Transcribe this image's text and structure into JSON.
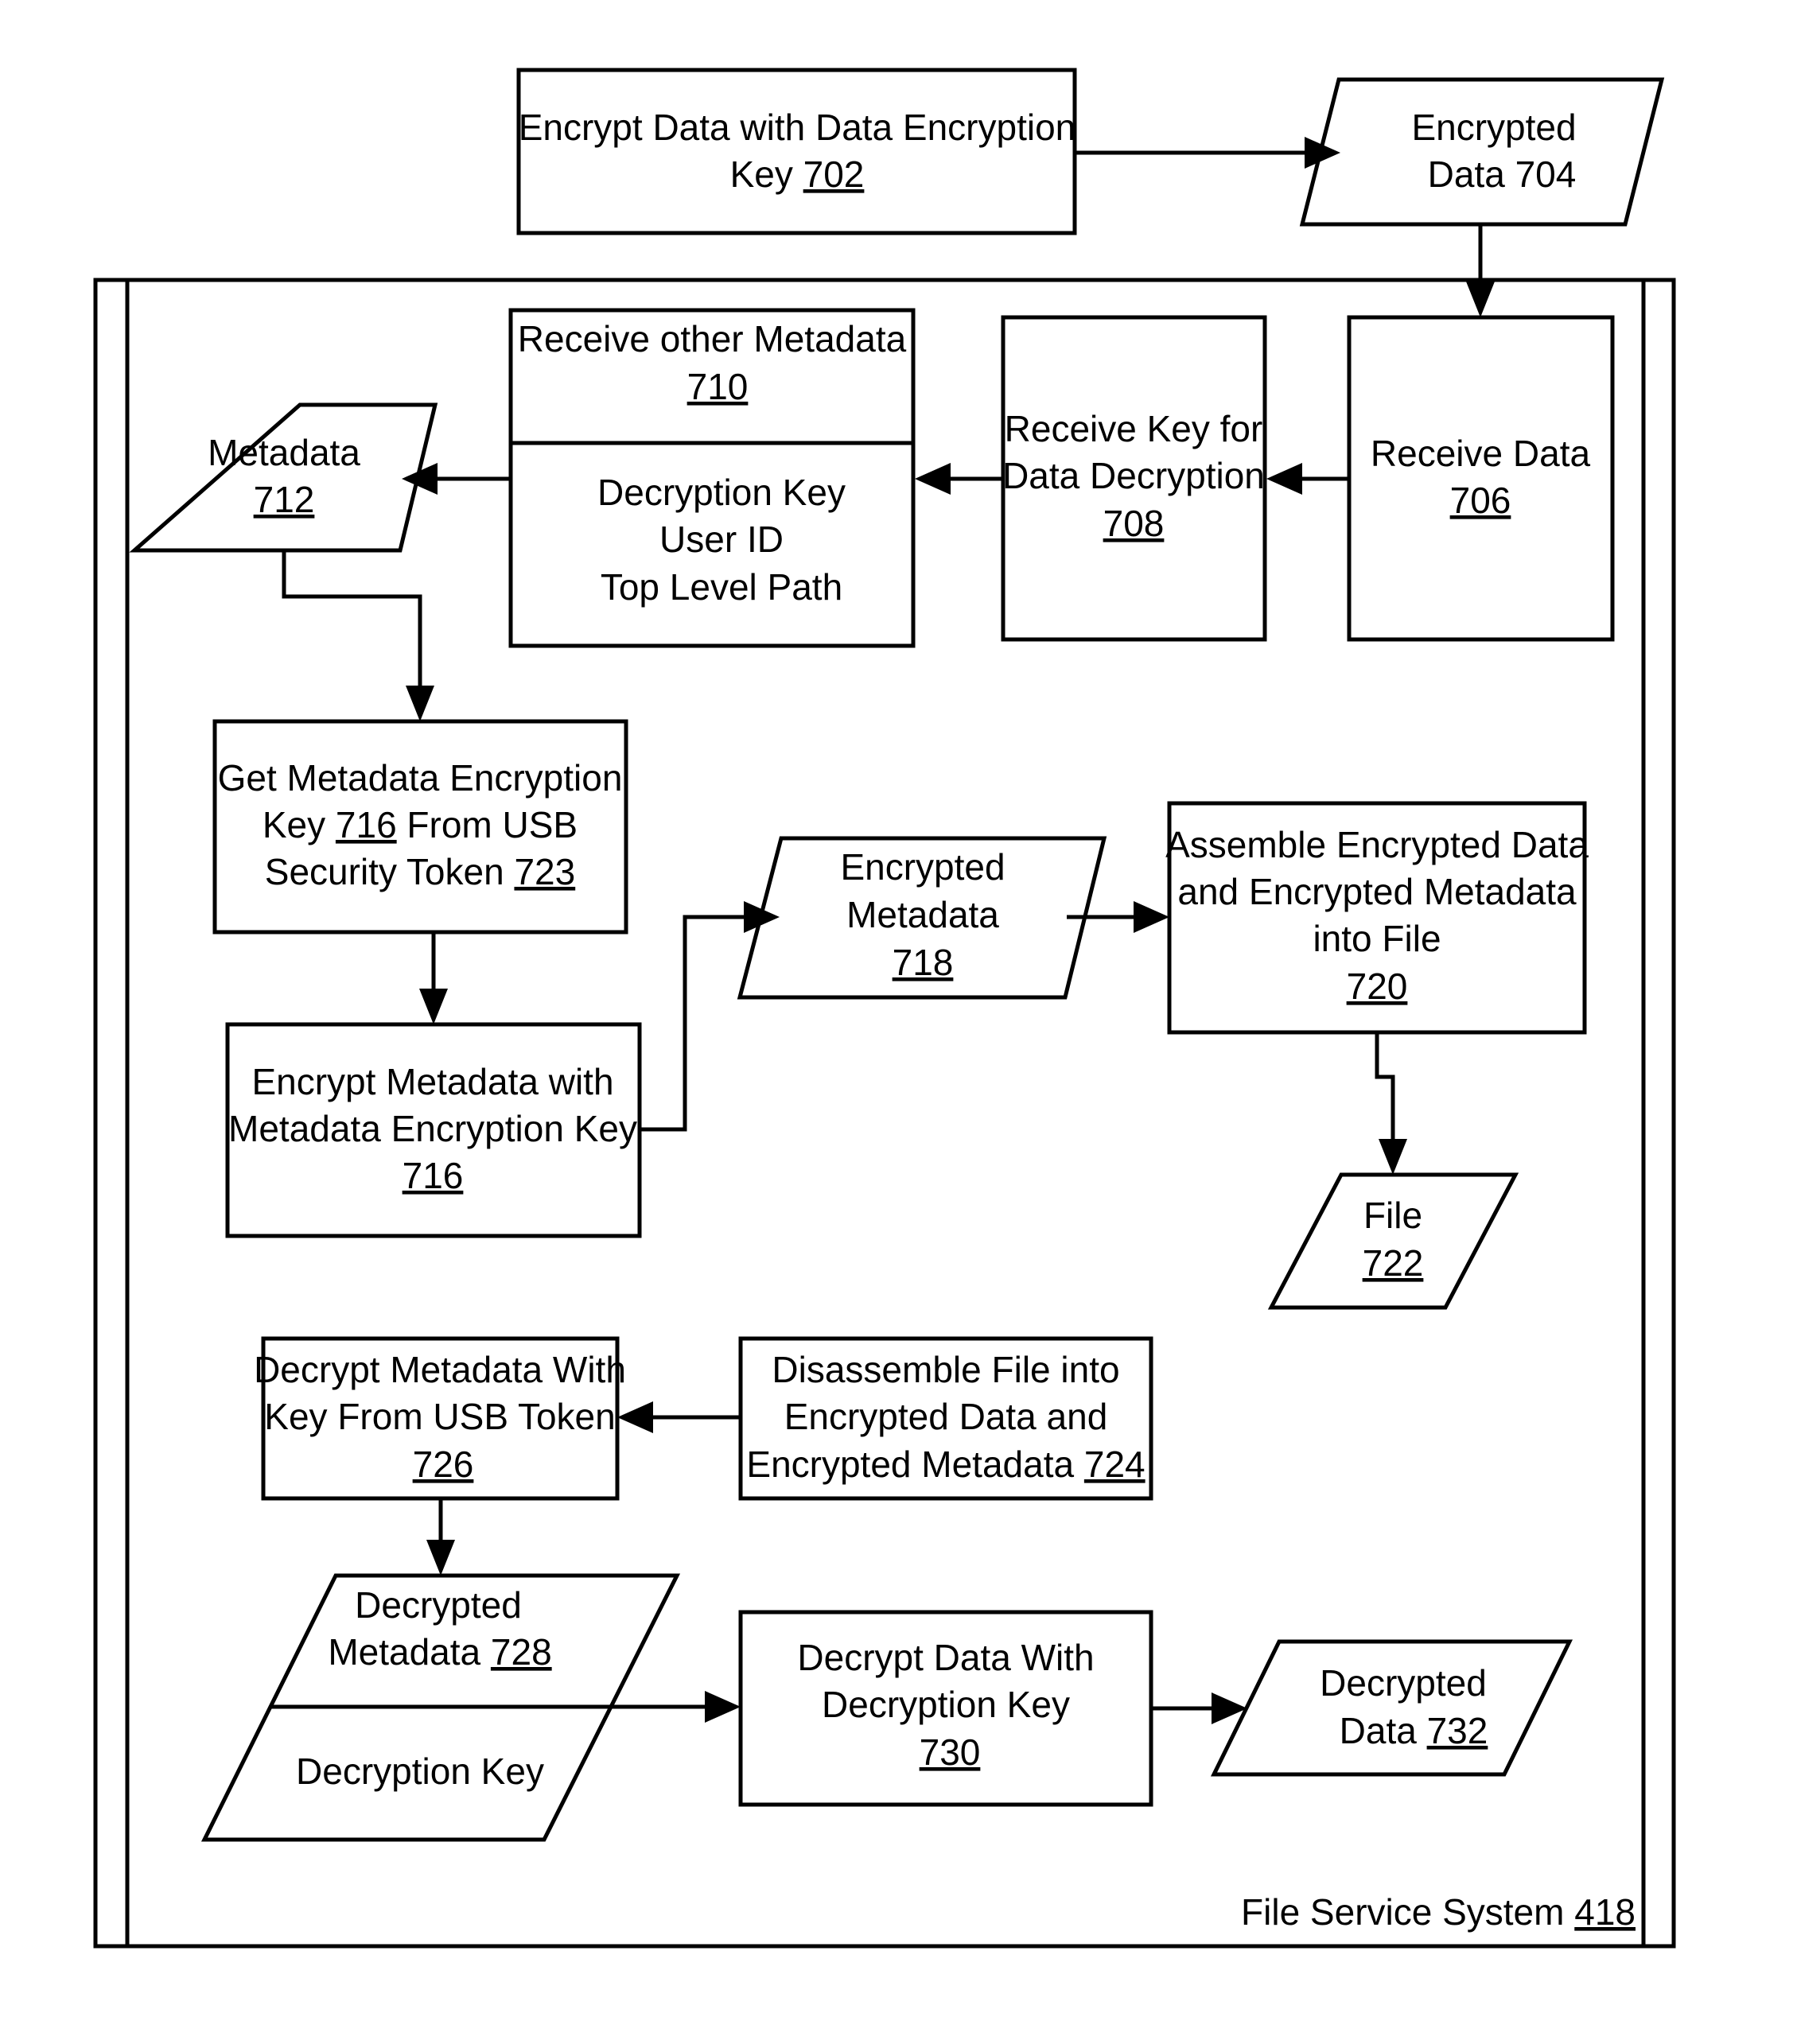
{
  "figure": {
    "container": {
      "label": "File Service System",
      "ref": "418"
    },
    "nodes": {
      "n702": {
        "shape": "process",
        "lines": [
          "Encrypt Data with Data Encryption"
        ],
        "tail": "Key",
        "ref": "702"
      },
      "n704": {
        "shape": "data",
        "lines": [
          "Encrypted",
          "Data 704"
        ]
      },
      "n706": {
        "shape": "process",
        "lines": [
          "Receive Data"
        ],
        "ref": "706"
      },
      "n708": {
        "shape": "process",
        "lines": [
          "Receive Key for",
          "Data Decryption"
        ],
        "ref": "708"
      },
      "n710": {
        "shape": "process-split",
        "lines": [
          "Receive other Metadata"
        ],
        "ref": "710",
        "fields": [
          "Decryption Key",
          "User ID",
          "Top Level Path"
        ]
      },
      "n712": {
        "shape": "data",
        "lines": [
          "Metadata"
        ],
        "ref": "712"
      },
      "n716a": {
        "shape": "process",
        "line1": "Get Metadata Encryption",
        "line2_pre": "Key ",
        "line2_ref": "716",
        "line2_post": " From USB",
        "line3_pre": "Security Token ",
        "line3_ref": "723"
      },
      "n716b": {
        "shape": "process",
        "lines": [
          "Encrypt Metadata with",
          "Metadata Encryption Key"
        ],
        "ref": "716"
      },
      "n718": {
        "shape": "data",
        "lines": [
          "Encrypted",
          "Metadata"
        ],
        "ref": "718"
      },
      "n720": {
        "shape": "process",
        "lines": [
          "Assemble Encrypted Data",
          "and Encrypted Metadata",
          "into File"
        ],
        "ref": "720"
      },
      "n722": {
        "shape": "data",
        "lines": [
          "File"
        ],
        "ref": "722"
      },
      "n724": {
        "shape": "process",
        "lines": [
          "Disassemble File into",
          "Encrypted Data and"
        ],
        "line3_pre": "Encrypted Metadata ",
        "ref": "724"
      },
      "n726": {
        "shape": "process",
        "lines": [
          "Decrypt Metadata With",
          "Key From USB Token"
        ],
        "ref": "726"
      },
      "n728": {
        "shape": "data-split",
        "lines": [
          "Decrypted"
        ],
        "line2_pre": "Metadata ",
        "ref": "728",
        "fields": [
          "Decryption Key"
        ]
      },
      "n730": {
        "shape": "process",
        "lines": [
          "Decrypt Data With",
          "Decryption Key"
        ],
        "ref": "730"
      },
      "n732": {
        "shape": "data",
        "lines": [
          "Decrypted"
        ],
        "line2_pre": "Data ",
        "ref": "732"
      }
    },
    "edges": [
      {
        "from": "702",
        "to": "704"
      },
      {
        "from": "704",
        "to": "706"
      },
      {
        "from": "706",
        "to": "708"
      },
      {
        "from": "708",
        "to": "710"
      },
      {
        "from": "710",
        "to": "712"
      },
      {
        "from": "712",
        "to": "716a"
      },
      {
        "from": "716a",
        "to": "716b"
      },
      {
        "from": "716b",
        "to": "718"
      },
      {
        "from": "718",
        "to": "720"
      },
      {
        "from": "720",
        "to": "722"
      },
      {
        "from": "724",
        "to": "726"
      },
      {
        "from": "726",
        "to": "728"
      },
      {
        "from": "728",
        "to": "730"
      },
      {
        "from": "730",
        "to": "732"
      }
    ]
  }
}
